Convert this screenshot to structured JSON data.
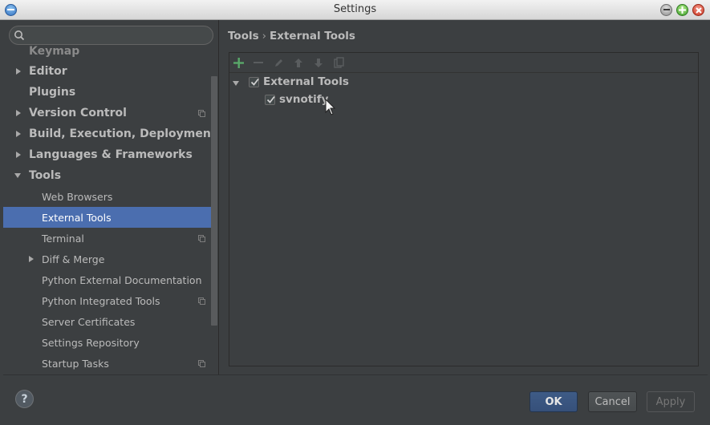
{
  "window": {
    "title": "Settings"
  },
  "search": {
    "value": "",
    "placeholder": ""
  },
  "sidebar": {
    "items": [
      {
        "label": "Keymap"
      },
      {
        "label": "Editor"
      },
      {
        "label": "Plugins"
      },
      {
        "label": "Version Control"
      },
      {
        "label": "Build, Execution, Deployment"
      },
      {
        "label": "Languages & Frameworks"
      },
      {
        "label": "Tools"
      },
      {
        "label": "Web Browsers"
      },
      {
        "label": "External Tools"
      },
      {
        "label": "Terminal"
      },
      {
        "label": "Diff & Merge"
      },
      {
        "label": "Python External Documentation"
      },
      {
        "label": "Python Integrated Tools"
      },
      {
        "label": "Server Certificates"
      },
      {
        "label": "Settings Repository"
      },
      {
        "label": "Startup Tasks"
      }
    ]
  },
  "breadcrumb": {
    "parent": "Tools",
    "separator": "›",
    "current": "External Tools"
  },
  "tools_tree": {
    "group": {
      "label": "External Tools",
      "checked": true
    },
    "items": [
      {
        "label": "svnotify",
        "checked": true
      }
    ]
  },
  "toolbar": {
    "icons": [
      "add-icon",
      "remove-icon",
      "edit-icon",
      "move-up-icon",
      "move-down-icon",
      "copy-icon"
    ]
  },
  "buttons": {
    "help": "?",
    "ok": "OK",
    "cancel": "Cancel",
    "apply": "Apply"
  },
  "colors": {
    "background": "#3c3f41",
    "selection": "#4b6eaf",
    "add_green": "#59a869"
  }
}
